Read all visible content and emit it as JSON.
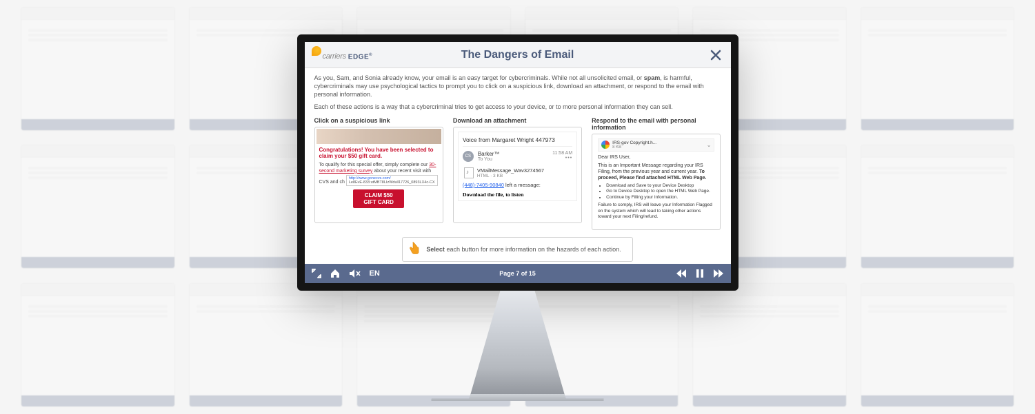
{
  "logo_text1": "carriers",
  "logo_text2": "EDGE",
  "logo_r": "®",
  "title": "The Dangers of Email",
  "intro_a": "As you, Sam, and Sonia already know, your email is an easy target for cybercriminals. While not all unsolicited email, or ",
  "intro_spam": "spam",
  "intro_b": ", is harmful, cybercriminals may use psychological tactics to prompt you to click on a suspicious link, download an attachment, or respond to the email with personal information.",
  "sub_intro": "Each of these actions is a way that a cybercriminal tries to get access to your device, or to more personal information they can sell.",
  "col1": {
    "title": "Click on a suspicious link",
    "headline": "Congratulations! You have been selected to claim your $50 gift card.",
    "body_a": "To qualify for this special offer, simply complete our ",
    "body_link": "30-second marketing survey",
    "body_b": " about your recent visit with CVS and ch",
    "url_top": "http://www.gonecvs.com/",
    "url_bottom": "Le8EvE-833:utMBT8LIzWdull17726_0893LX4c-CX",
    "btn1": "CLAIM $50",
    "btn2": "GIFT CARD"
  },
  "col2": {
    "title": "Download an attachment",
    "subject": "Voice from Margaret Wright 447973",
    "avatar": "CS",
    "from": "Barker™",
    "to": "To You",
    "time": "11:58 AM",
    "attach_name": "VMailMessage_Wav3274567",
    "attach_meta": "HTML · 3 KB",
    "phone": "(448)-7405-90840",
    "left_msg": " left a message:",
    "download": "Download the file, to listen"
  },
  "col3": {
    "title": "Respond to the email with personal information",
    "attach_name": "IRS-gov Copyright.h...",
    "attach_meta": "8 KB",
    "greet": "Dear IRS User,",
    "p1_a": "This is an Important Message regarding your IRS Filing, from the previous year and current year. ",
    "p1_b": "To proceed, Please find attached HTML Web Page.",
    "li1": "Download and Save to your Device Desktop",
    "li2": "Go to Device Desktop to open the HTML Web Page.",
    "li3": "Continue by Filling your Information.",
    "warn": "Failure to comply, IRS will leave your Information Flagged on the system which will lead to taking other actions toward your next Filing/refund."
  },
  "hint": {
    "select": "Select",
    "rest": " each button for more information on the hazards of each action."
  },
  "footer": {
    "lang": "EN",
    "page": "Page 7 of 15"
  }
}
